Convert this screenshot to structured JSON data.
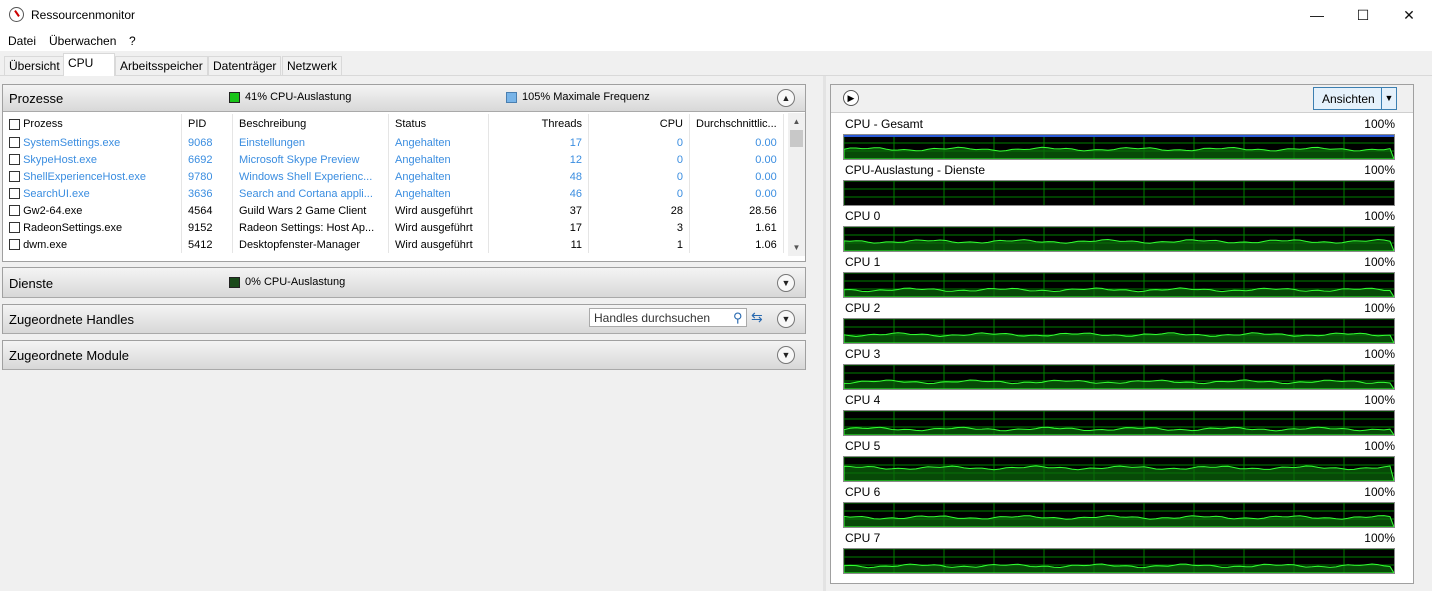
{
  "window": {
    "title": "Ressourcenmonitor",
    "minimize": "—",
    "maximize": "☐",
    "close": "✕"
  },
  "menu": [
    "Datei",
    "Überwachen",
    "?"
  ],
  "tabs": [
    "Übersicht",
    "CPU",
    "Arbeitsspeicher",
    "Datenträger",
    "Netzwerk"
  ],
  "processes": {
    "title": "Prozesse",
    "cpu_usage": "41% CPU-Auslastung",
    "max_freq": "105% Maximale Frequenz",
    "columns": [
      "Prozess",
      "PID",
      "Beschreibung",
      "Status",
      "Threads",
      "CPU",
      "Durchschnittlic..."
    ],
    "rows": [
      {
        "name": "SystemSettings.exe",
        "pid": "9068",
        "desc": "Einstellungen",
        "status": "Angehalten",
        "threads": "17",
        "cpu": "0",
        "avg": "0.00",
        "suspended": true
      },
      {
        "name": "SkypeHost.exe",
        "pid": "6692",
        "desc": "Microsoft Skype Preview",
        "status": "Angehalten",
        "threads": "12",
        "cpu": "0",
        "avg": "0.00",
        "suspended": true
      },
      {
        "name": "ShellExperienceHost.exe",
        "pid": "9780",
        "desc": "Windows Shell Experienc...",
        "status": "Angehalten",
        "threads": "48",
        "cpu": "0",
        "avg": "0.00",
        "suspended": true
      },
      {
        "name": "SearchUI.exe",
        "pid": "3636",
        "desc": "Search and Cortana appli...",
        "status": "Angehalten",
        "threads": "46",
        "cpu": "0",
        "avg": "0.00",
        "suspended": true
      },
      {
        "name": "Gw2-64.exe",
        "pid": "4564",
        "desc": "Guild Wars 2 Game Client",
        "status": "Wird ausgeführt",
        "threads": "37",
        "cpu": "28",
        "avg": "28.56",
        "suspended": false
      },
      {
        "name": "RadeonSettings.exe",
        "pid": "9152",
        "desc": "Radeon Settings: Host Ap...",
        "status": "Wird ausgeführt",
        "threads": "17",
        "cpu": "3",
        "avg": "1.61",
        "suspended": false
      },
      {
        "name": "dwm.exe",
        "pid": "5412",
        "desc": "Desktopfenster-Manager",
        "status": "Wird ausgeführt",
        "threads": "11",
        "cpu": "1",
        "avg": "1.06",
        "suspended": false
      }
    ]
  },
  "services": {
    "title": "Dienste",
    "cpu_usage": "0% CPU-Auslastung"
  },
  "handles": {
    "title": "Zugeordnete Handles",
    "search_placeholder": "Handles durchsuchen"
  },
  "modules": {
    "title": "Zugeordnete Module"
  },
  "graphs_panel": {
    "views_button": "Ansichten",
    "graphs": [
      {
        "title": "CPU - Gesamt",
        "max": "100%",
        "level": 0.41
      },
      {
        "title": "CPU-Auslastung - Dienste",
        "max": "100%",
        "level": 0.0
      },
      {
        "title": "CPU 0",
        "max": "100%",
        "level": 0.4
      },
      {
        "title": "CPU 1",
        "max": "100%",
        "level": 0.3
      },
      {
        "title": "CPU 2",
        "max": "100%",
        "level": 0.35
      },
      {
        "title": "CPU 3",
        "max": "100%",
        "level": 0.3
      },
      {
        "title": "CPU 4",
        "max": "100%",
        "level": 0.25
      },
      {
        "title": "CPU 5",
        "max": "100%",
        "level": 0.55
      },
      {
        "title": "CPU 6",
        "max": "100%",
        "level": 0.4
      },
      {
        "title": "CPU 7",
        "max": "100%",
        "level": 0.3
      }
    ]
  },
  "colors": {
    "graph_bg": "#000000",
    "graph_grid": "#008000",
    "graph_line": "#33ff33",
    "suspended_text": "#3a8de0"
  }
}
